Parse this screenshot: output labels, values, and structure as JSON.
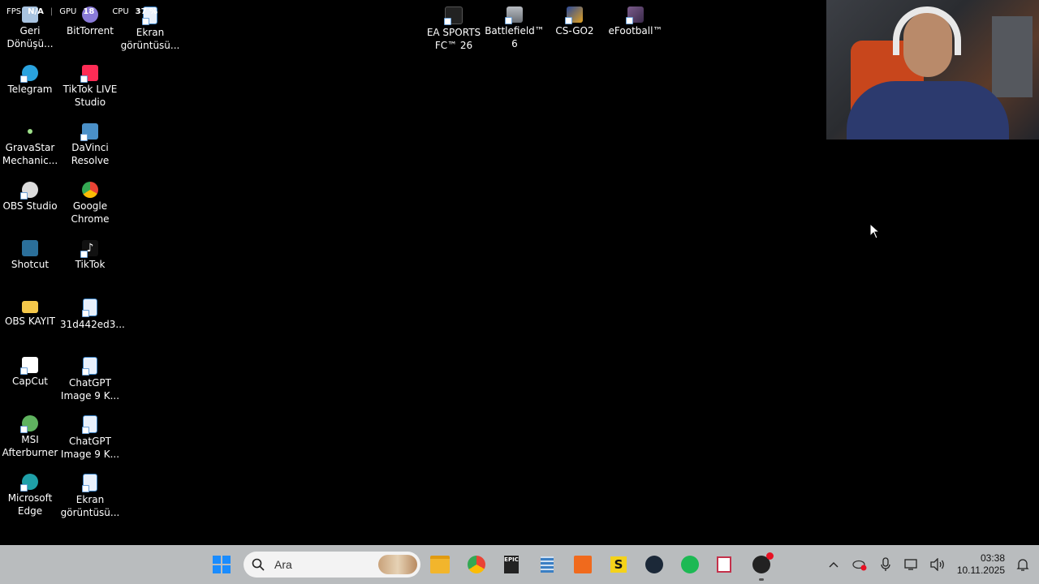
{
  "overlay": {
    "fps_label": "FPS",
    "fps_value": "N/A",
    "gpu_label": "GPU",
    "gpu_value": "18",
    "cpu_label": "CPU",
    "cpu_value": "37 %"
  },
  "desktop": {
    "icons": [
      {
        "label": "Geri Dönüşü...",
        "icon": "recycle-bin-icon",
        "color": "#a9c4e0"
      },
      {
        "label": "BitTorrent",
        "icon": "bittorrent-icon",
        "color": "#8a7bd8"
      },
      {
        "label": "Ekran görüntüsü...",
        "icon": "image-file-icon",
        "color": "#3b82c4"
      },
      {
        "label": "Telegram",
        "icon": "telegram-icon",
        "color": "#2aa3df"
      },
      {
        "label": "TikTok LIVE Studio",
        "icon": "tiktok-live-studio-icon",
        "color": "#fe2c55"
      },
      {
        "label": "GravaStar Mechanic...",
        "icon": "gravastar-icon",
        "color": "#9ee08a"
      },
      {
        "label": "DaVinci Resolve",
        "icon": "davinci-resolve-icon",
        "color": "#4a90c8"
      },
      {
        "label": "OBS Studio",
        "icon": "obs-studio-icon",
        "color": "#dddddd"
      },
      {
        "label": "Google Chrome",
        "icon": "chrome-icon",
        "color": "#ea4335"
      },
      {
        "label": "Shotcut",
        "icon": "shotcut-icon",
        "color": "#2b6f9a"
      },
      {
        "label": "TikTok",
        "icon": "tiktok-icon",
        "color": "#111111"
      },
      {
        "label": "OBS KAYIT",
        "icon": "folder-icon",
        "color": "#f5c84a"
      },
      {
        "label": "31d442ed3...",
        "icon": "image-file-icon",
        "color": "#3b82c4"
      },
      {
        "label": "CapCut",
        "icon": "capcut-icon",
        "color": "#ffffff"
      },
      {
        "label": "ChatGPT Image 9 K...",
        "icon": "image-file-icon",
        "color": "#3b82c4"
      },
      {
        "label": "MSI Afterburner",
        "icon": "msi-afterburner-icon",
        "color": "#5fb35f"
      },
      {
        "label": "ChatGPT Image 9 K...",
        "icon": "image-file-icon",
        "color": "#3b82c4"
      },
      {
        "label": "Microsoft Edge",
        "icon": "edge-icon",
        "color": "#1fa0a8"
      },
      {
        "label": "Ekran görüntüsü...",
        "icon": "image-file-icon",
        "color": "#3b82c4"
      },
      {
        "label": "EA SPORTS FC™ 26",
        "icon": "ea-sports-fc-icon",
        "color": "#222222"
      },
      {
        "label": "Battlefield™ 6",
        "icon": "battlefield-icon",
        "color": "#8a8f95"
      },
      {
        "label": "CS-GO2",
        "icon": "csgo-icon",
        "color": "#e0a020"
      },
      {
        "label": "eFootball™",
        "icon": "efootball-icon",
        "color": "#7a5a8a"
      }
    ]
  },
  "taskbar": {
    "search_placeholder": "Ara",
    "pinned": [
      {
        "icon": "file-explorer-icon",
        "color": "#f2b52c"
      },
      {
        "icon": "chrome-icon",
        "color": "#ea4335"
      },
      {
        "icon": "epic-games-icon",
        "color": "#222222"
      },
      {
        "icon": "calculator-icon",
        "color": "#3b7fc4"
      },
      {
        "icon": "app-orange-icon",
        "color": "#f06a1d"
      },
      {
        "icon": "s-app-icon",
        "color": "#f4d21a"
      },
      {
        "icon": "steam-icon",
        "color": "#1b2838"
      },
      {
        "icon": "spotify-icon",
        "color": "#1db954"
      },
      {
        "icon": "snipping-tool-icon",
        "color": "#c4314b"
      },
      {
        "icon": "obs-studio-icon",
        "color": "#222222"
      }
    ],
    "clock_time": "03:38",
    "clock_date": "10.11.2025"
  }
}
